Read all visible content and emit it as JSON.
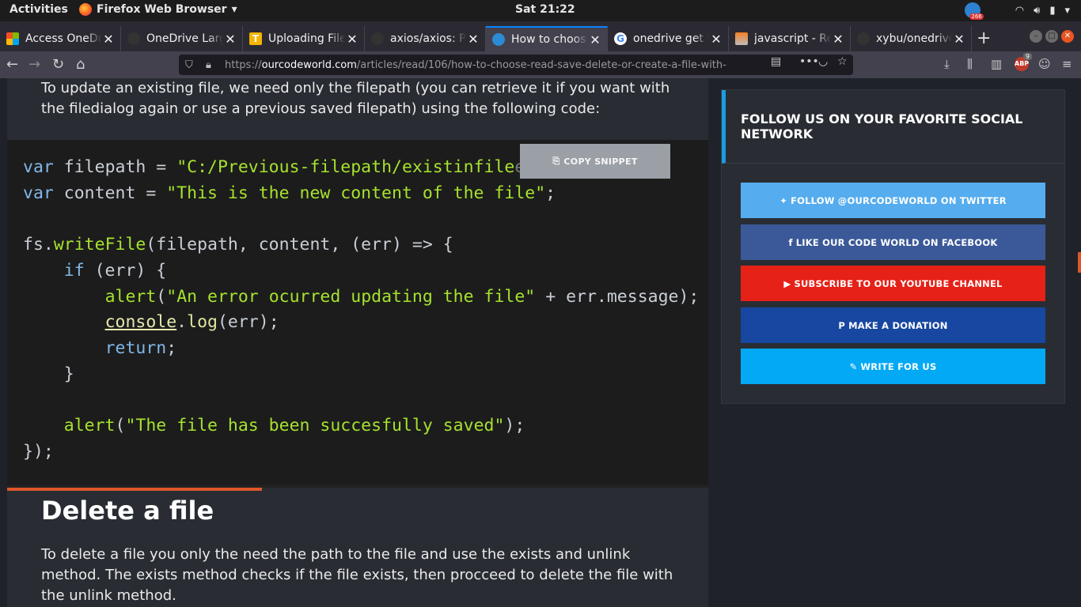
{
  "topbar": {
    "activities": "Activities",
    "app_name": "Firefox Web Browser",
    "clock": "Sat 21:22",
    "notif_count": "266"
  },
  "tabs": [
    {
      "title": "Access OneDr",
      "favicon": "windows-logo",
      "color": "#f25022"
    },
    {
      "title": "OneDrive Larg",
      "favicon": "github-icon",
      "color": "#333333"
    },
    {
      "title": "Uploading File",
      "favicon": "t-logo",
      "color": "#f5b400"
    },
    {
      "title": "axios/axios: P",
      "favicon": "github-icon",
      "color": "#333333"
    },
    {
      "title": "How to choos",
      "favicon": "ourcodeworld-icon",
      "color": "#2d8bd6"
    },
    {
      "title": "onedrive get t",
      "favicon": "google-icon",
      "color": "#ffffff"
    },
    {
      "title": "javascript - Re",
      "favicon": "stackoverflow-icon",
      "color": "#f48024"
    },
    {
      "title": "xybu/onedrive",
      "favicon": "github-icon",
      "color": "#333333"
    }
  ],
  "navbar": {
    "url_prefix": "https://",
    "url_host": "ourcodeworld.com",
    "url_path": "/articles/read/106/how-to-choose-read-save-delete-or-create-a-file-with-",
    "abp_badge": "9",
    "abp_label": "ABP"
  },
  "article": {
    "intro": "To update an existing file, we need only the filepath (you can retrieve it if you want with the filedialog again or use a previous saved filepath) using the following code:",
    "copy_label": "COPY SNIPPET",
    "heading": "Delete a file",
    "delete_text": "To delete a file you only the need the path to the file and use the exists and unlink method. The exists method checks if the file exists, then procceed to delete the file with the unlink method."
  },
  "code": {
    "l1_kw": "var",
    "l1_rest": " filepath = ",
    "l1_str": "\"C:/Previous-filepath/existinfile",
    "l1_tail": "ed ",
    "l2_kw": "var",
    "l2_rest": " content = ",
    "l2_str": "\"This is the new content of the file\"",
    "l2_end": ";",
    "l4_a": "fs.",
    "l4_fn": "writeFile",
    "l4_b": "(filepath, content, (err) => {",
    "l5_kw": "if",
    "l5_b": " (err) {",
    "l6_fn": "alert",
    "l6_a": "(",
    "l6_str": "\"An error ocurred updating the file\"",
    "l6_b": " + err.message);",
    "l7_con": "console",
    "l7_a": ".",
    "l7_fn": "log",
    "l7_b": "(err);",
    "l8_kw": "return",
    "l8_b": ";",
    "l9": "}",
    "l11_fn": "alert",
    "l11_a": "(",
    "l11_str": "\"The file has been succesfully saved\"",
    "l11_b": ");",
    "l12": "});"
  },
  "sidebar": {
    "title": "FOLLOW US ON YOUR FAVORITE SOCIAL NETWORK",
    "buttons": [
      {
        "label": "FOLLOW @OURCODEWORLD ON TWITTER",
        "icon": "twitter-icon",
        "color": "#55acee"
      },
      {
        "label": "LIKE OUR CODE WORLD ON FACEBOOK",
        "icon": "facebook-icon",
        "color": "#3b5998"
      },
      {
        "label": "SUBSCRIBE TO OUR YOUTUBE CHANNEL",
        "icon": "youtube-icon",
        "color": "#e62117"
      },
      {
        "label": "MAKE A DONATION",
        "icon": "paypal-icon",
        "color": "#1747a0"
      },
      {
        "label": "WRITE FOR US",
        "icon": "edit-icon",
        "color": "#03a9f4"
      }
    ]
  }
}
